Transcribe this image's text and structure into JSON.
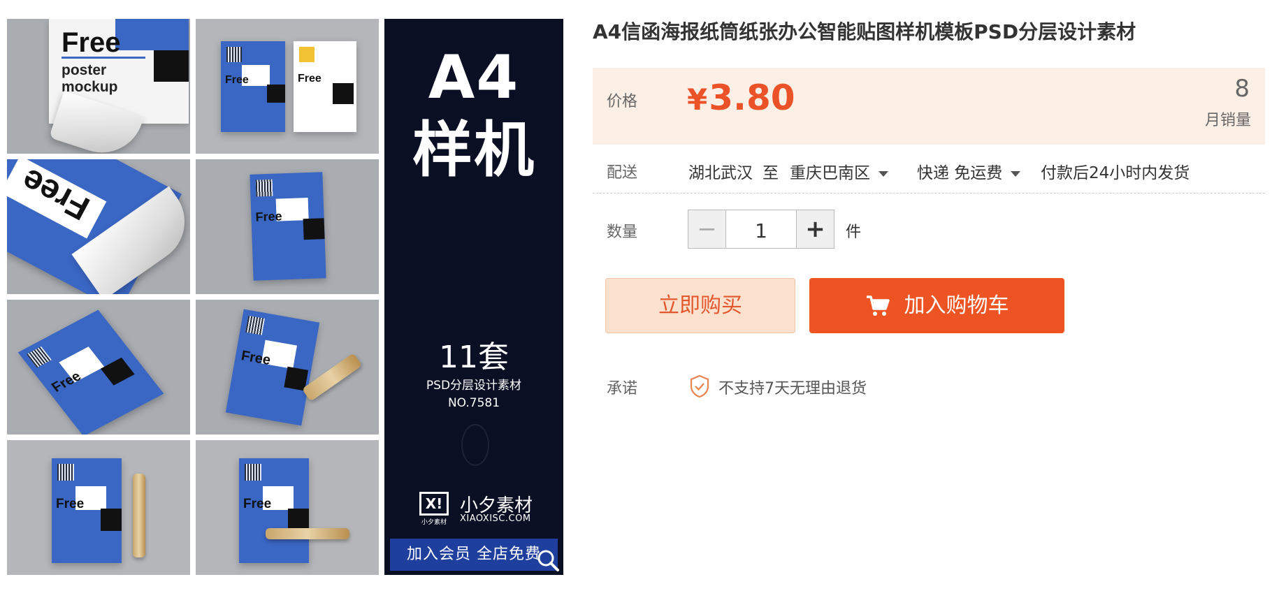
{
  "gallery": {
    "tile_text": {
      "free": "Free",
      "poster": "poster",
      "mockup": "mockup"
    },
    "banner": {
      "title_line1": "A4",
      "title_line2": "样机",
      "count": "11套",
      "subtitle": "PSD分层设计素材",
      "number": "NO.7581",
      "logo_mark": "X!",
      "logo_small": "小夕素材",
      "brand": "小夕素材",
      "domain": "XIAOXISC.COM",
      "cta": "加入会员 全店免费"
    }
  },
  "product": {
    "title": "A4信函海报纸筒纸张办公智能贴图样机模板PSD分层设计素材",
    "price_label": "价格",
    "currency": "¥",
    "price": "3.80",
    "monthly_sales": "8",
    "monthly_sales_label": "月销量",
    "shipping": {
      "label": "配送",
      "from": "湖北武汉",
      "to_word": "至",
      "destination": "重庆巴南区",
      "method": "快递 免运费",
      "dispatch": "付款后24小时内发货"
    },
    "quantity": {
      "label": "数量",
      "value": "1",
      "unit": "件",
      "minus": "−",
      "plus": "+"
    },
    "buttons": {
      "buy_now": "立即购买",
      "add_to_cart": "加入购物车"
    },
    "promise": {
      "label": "承诺",
      "text": "不支持7天无理由退货"
    }
  },
  "colors": {
    "accent": "#ee5423",
    "price": "#ec5228",
    "price_bg": "#fcefe6",
    "buy_bg": "#fde1cf",
    "banner_bg": "#0b0f24",
    "poster_blue": "#3a66c4"
  },
  "icons": [
    "cart-icon",
    "shield-check-icon",
    "zoom-icon",
    "caret-down-icon"
  ]
}
